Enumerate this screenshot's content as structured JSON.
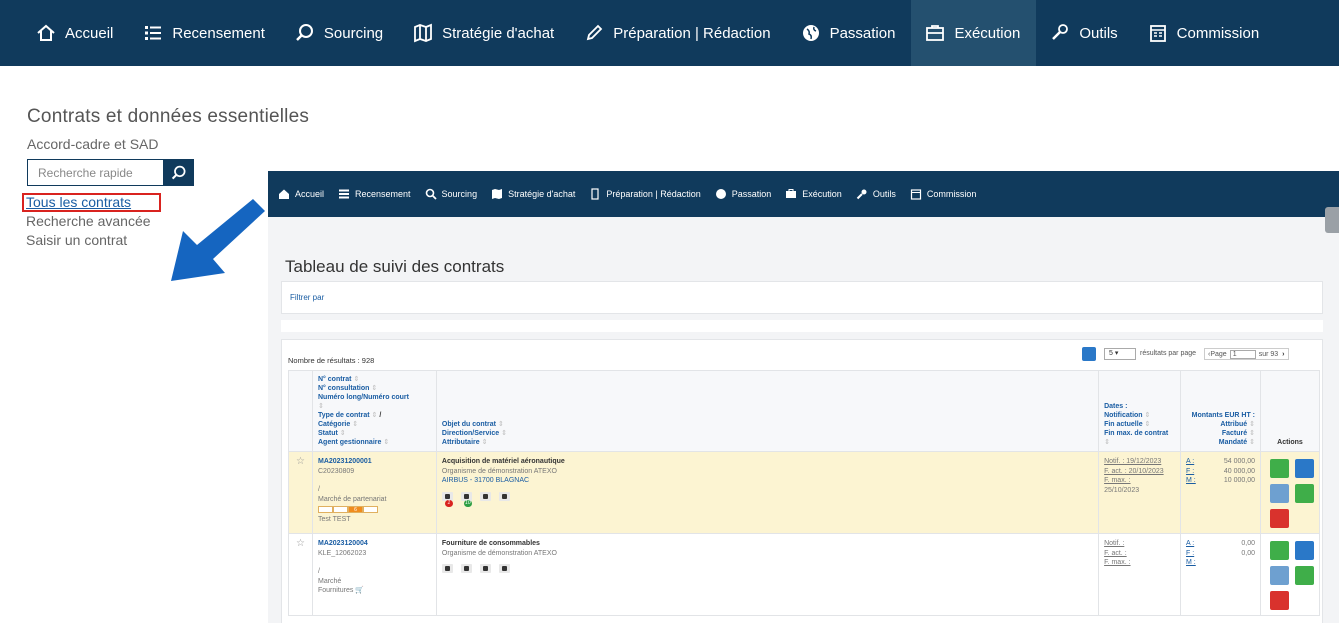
{
  "nav": {
    "items": [
      {
        "label": "Accueil",
        "icon": "home-icon"
      },
      {
        "label": "Recensement",
        "icon": "list-icon"
      },
      {
        "label": "Sourcing",
        "icon": "search-icon"
      },
      {
        "label": "Stratégie d'achat",
        "icon": "map-icon"
      },
      {
        "label": "Préparation | Rédaction",
        "icon": "pencil-icon"
      },
      {
        "label": "Passation",
        "icon": "globe-icon"
      },
      {
        "label": "Exécution",
        "icon": "briefcase-icon"
      },
      {
        "label": "Outils",
        "icon": "wrench-icon"
      },
      {
        "label": "Commission",
        "icon": "calendar-icon"
      }
    ],
    "active_index": 6
  },
  "left": {
    "title": "Contrats et données essentielles",
    "subtitle": "Accord-cadre et SAD",
    "search_placeholder": "Recherche rapide",
    "links": [
      "Tous les contrats",
      "Recherche avancée",
      "Saisir un contrat"
    ]
  },
  "inner": {
    "title": "Tableau de suivi des contrats",
    "filter_label": "Filtrer par",
    "results_count": "Nombre de résultats : 928",
    "per_page_value": "5",
    "per_page_label": "résultats par page",
    "page_label": "Page",
    "page_value": "1",
    "page_total": "sur 93",
    "columns": {
      "col1": [
        "N° contrat",
        "N° consultation",
        "Numéro long/Numéro court",
        "Type de contrat",
        "Catégorie",
        "Statut",
        "Agent gestionnaire"
      ],
      "col1_sep": "/",
      "col2": [
        "Objet du contrat",
        "Direction/Service",
        "Attributaire"
      ],
      "col3": [
        "Dates :",
        "Notification",
        "Fin actuelle",
        "Fin max. de contrat"
      ],
      "col4": [
        "Montants EUR HT :",
        "Attribué",
        "Facturé",
        "Mandaté"
      ],
      "col5": "Actions"
    },
    "rows": [
      {
        "num": "MA20231200001",
        "consultation": "C20230809",
        "sep": "/",
        "type": "Marché de partenariat",
        "status_step": "6",
        "agent": "Test TEST",
        "objet": "Acquisition de matériel aéronautique",
        "direction": "Organisme de démonstration ATEXO",
        "attributaire": "AIRBUS - 31700 BLAGNAC",
        "badge_red": "1",
        "badge_green": "10",
        "notif": "Notif. : 19/12/2023",
        "fin_act": "F. act. : 20/10/2023",
        "fin_max_label": "F. max. :",
        "fin_max": "25/10/2023",
        "amount_labels": [
          "A :",
          "F :",
          "M :"
        ],
        "amounts": [
          "54 000,00",
          "40 000,00",
          "10 000,00"
        ]
      },
      {
        "num": "MA2023120004",
        "consultation": "KLE_12062023",
        "sep": "/",
        "type": "Marché",
        "category": "Fournitures",
        "objet": "Fourniture de consommables",
        "direction": "Organisme de démonstration ATEXO",
        "notif": "Notif. :",
        "fin_act": "F. act. :",
        "fin_max_label": "F. max. :",
        "amount_labels": [
          "A :",
          "F :",
          "M :"
        ],
        "amounts": [
          "0,00",
          "0,00",
          ""
        ]
      }
    ]
  },
  "colors": {
    "nav_bg": "#103a5c",
    "nav_active": "#24506f",
    "link_blue": "#1a5da3",
    "highlight": "#d9231f",
    "arrow": "#1565c0",
    "row_highlight": "#fcf4d2"
  }
}
